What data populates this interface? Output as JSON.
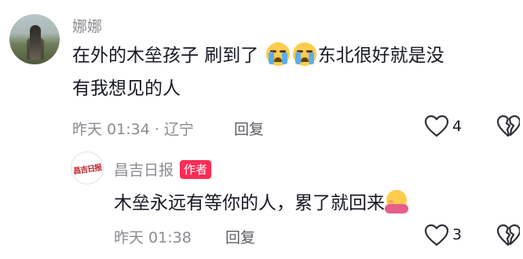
{
  "comment1": {
    "username": "娜娜",
    "text_line1_a": "在外的木垒孩子 刷到了 ",
    "text_line1_b": "东北很好就是没",
    "text_line2": "有我想见的人",
    "emoji_icon": "loudly-crying-face-icon",
    "time_location": "昨天 01:34 · 辽宁",
    "reply_label": "回复",
    "like_count": "4"
  },
  "comment2": {
    "username": "昌吉日报",
    "author_badge": "作者",
    "avatar_logo_text": "昌吉日报",
    "text": "木垒永远有等你的人，累了就回来",
    "emoji_icon": "hugging-face-icon",
    "time": "昨天 01:38",
    "reply_label": "回复",
    "like_count": "3"
  },
  "colors": {
    "text_primary": "#161823",
    "text_secondary": "#8a8b91",
    "badge_bg": "#fe2c55"
  }
}
